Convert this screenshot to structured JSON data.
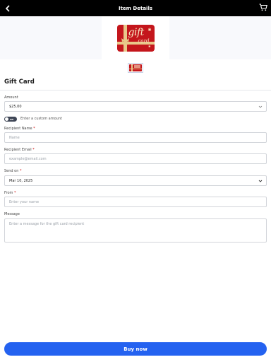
{
  "header": {
    "title": "Item Details",
    "back_icon": "chevron-left-icon",
    "cart_icon": "cart-icon"
  },
  "product": {
    "card_word_gift": "gift",
    "card_word_card": "card",
    "title": "Gift Card"
  },
  "form": {
    "amount": {
      "label": "Amount",
      "value": "$25.00"
    },
    "custom_toggle": {
      "state": "Off",
      "label": "Enter a custom amount"
    },
    "recipient_name": {
      "label": "Recipient Name",
      "required": "*",
      "placeholder": "Name"
    },
    "recipient_email": {
      "label": "Recipient Email",
      "required": "*",
      "placeholder": "example@email.com"
    },
    "send_on": {
      "label": "Send on",
      "required": "*",
      "value": "Mar 10, 2025"
    },
    "from": {
      "label": "From",
      "required": "*",
      "placeholder": "Enter your name"
    },
    "message": {
      "label": "Message",
      "placeholder": "Enter a message for the gift card recipient"
    }
  },
  "actions": {
    "buy_label": "Buy now"
  },
  "colors": {
    "header_bg": "#000000",
    "primary": "#2462f0",
    "card_red": "#c4161c"
  }
}
